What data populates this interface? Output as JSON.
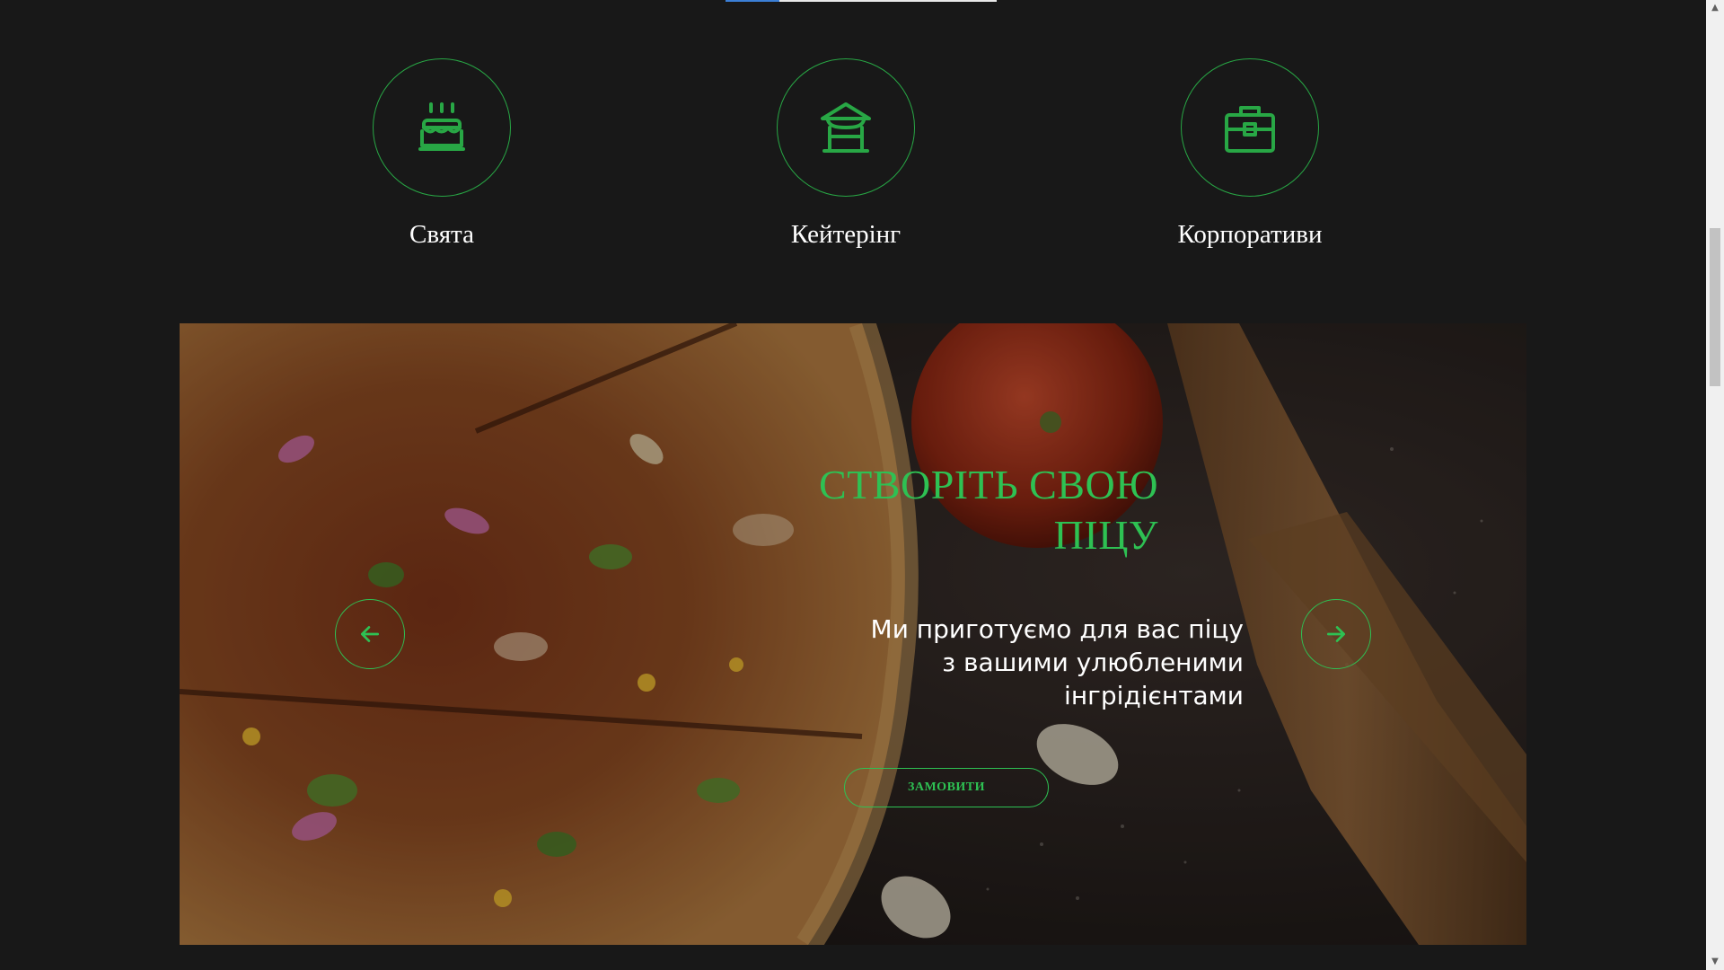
{
  "services": [
    {
      "label": "Свята",
      "icon": "cake-icon"
    },
    {
      "label": "Кейтерінг",
      "icon": "pavilion-icon"
    },
    {
      "label": "Корпоративи",
      "icon": "briefcase-icon"
    }
  ],
  "hero": {
    "title_line1": "СТВОРІТЬ СВОЮ",
    "title_line2": "ПІЦУ",
    "subtitle_line1": "Ми приготуємо для вас піцу",
    "subtitle_line2": "з вашими улюбленими",
    "subtitle_line3": "інгрідієнтами",
    "order_button": "ЗАМОВИТИ",
    "prev_icon": "arrow-left-icon",
    "next_icon": "arrow-right-icon"
  },
  "colors": {
    "background": "#181818",
    "accent": "#2ec153",
    "text": "#ffffff"
  }
}
